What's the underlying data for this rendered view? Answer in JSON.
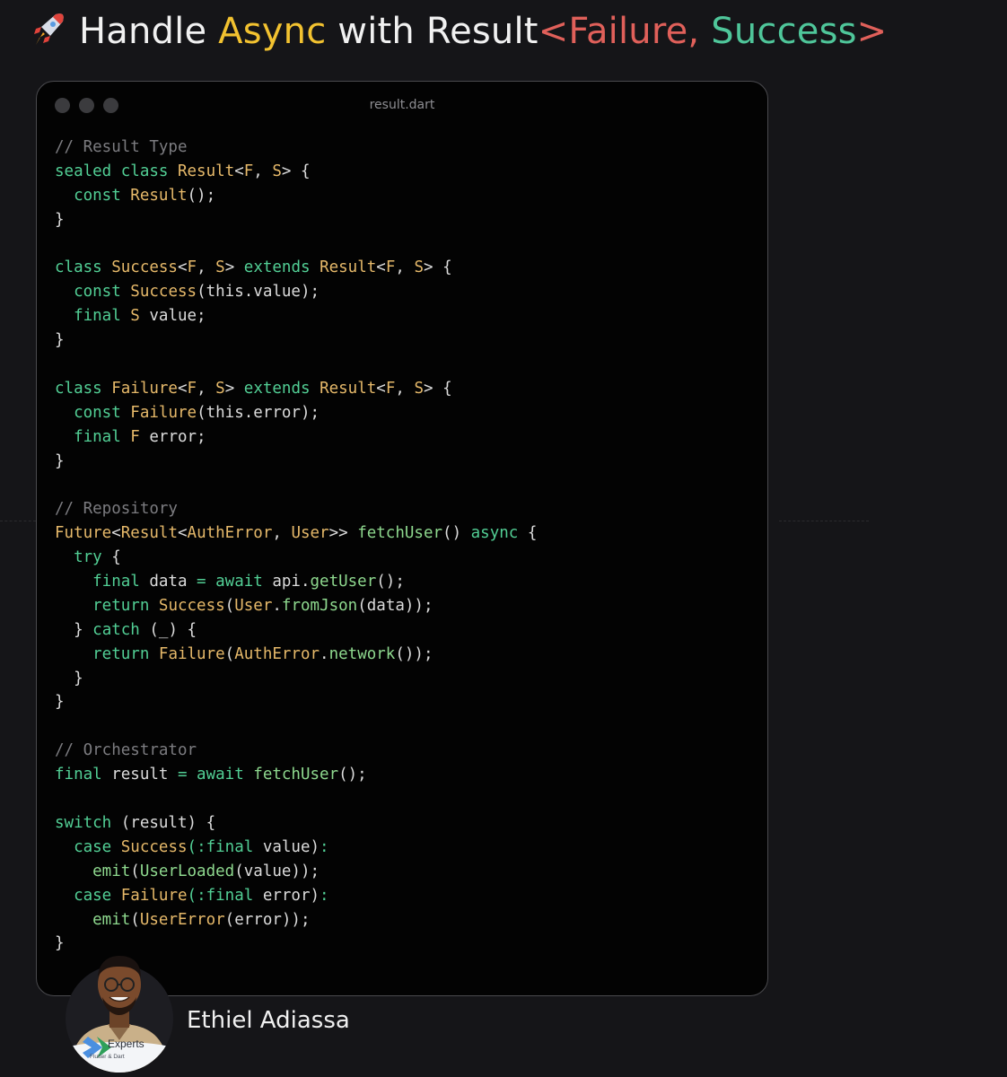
{
  "title": {
    "part1": "Handle ",
    "async": "Async",
    "part2": " with Result",
    "open": "<",
    "failure": "Failure,",
    "space": " ",
    "success": "Success",
    "close": ">"
  },
  "window": {
    "filename": "result.dart"
  },
  "code_lines": [
    [
      {
        "t": "// Result Type",
        "c": "comment"
      }
    ],
    [
      {
        "t": "sealed class ",
        "c": "kw"
      },
      {
        "t": "Result",
        "c": "type"
      },
      {
        "t": "<",
        "c": "plain"
      },
      {
        "t": "F",
        "c": "type"
      },
      {
        "t": ", ",
        "c": "plain"
      },
      {
        "t": "S",
        "c": "type"
      },
      {
        "t": "> {",
        "c": "plain"
      }
    ],
    [
      {
        "t": "  const ",
        "c": "kw"
      },
      {
        "t": "Result",
        "c": "type"
      },
      {
        "t": "();",
        "c": "plain"
      }
    ],
    [
      {
        "t": "}",
        "c": "plain"
      }
    ],
    [],
    [
      {
        "t": "class ",
        "c": "kw"
      },
      {
        "t": "Success",
        "c": "type"
      },
      {
        "t": "<",
        "c": "plain"
      },
      {
        "t": "F",
        "c": "type"
      },
      {
        "t": ", ",
        "c": "plain"
      },
      {
        "t": "S",
        "c": "type"
      },
      {
        "t": "> ",
        "c": "plain"
      },
      {
        "t": "extends ",
        "c": "kw"
      },
      {
        "t": "Result",
        "c": "type"
      },
      {
        "t": "<",
        "c": "plain"
      },
      {
        "t": "F",
        "c": "type"
      },
      {
        "t": ", ",
        "c": "plain"
      },
      {
        "t": "S",
        "c": "type"
      },
      {
        "t": "> {",
        "c": "plain"
      }
    ],
    [
      {
        "t": "  const ",
        "c": "kw"
      },
      {
        "t": "Success",
        "c": "type"
      },
      {
        "t": "(this.value);",
        "c": "plain"
      }
    ],
    [
      {
        "t": "  final ",
        "c": "kw"
      },
      {
        "t": "S",
        "c": "type"
      },
      {
        "t": " value;",
        "c": "plain"
      }
    ],
    [
      {
        "t": "}",
        "c": "plain"
      }
    ],
    [],
    [
      {
        "t": "class ",
        "c": "kw"
      },
      {
        "t": "Failure",
        "c": "type"
      },
      {
        "t": "<",
        "c": "plain"
      },
      {
        "t": "F",
        "c": "type"
      },
      {
        "t": ", ",
        "c": "plain"
      },
      {
        "t": "S",
        "c": "type"
      },
      {
        "t": "> ",
        "c": "plain"
      },
      {
        "t": "extends ",
        "c": "kw"
      },
      {
        "t": "Result",
        "c": "type"
      },
      {
        "t": "<",
        "c": "plain"
      },
      {
        "t": "F",
        "c": "type"
      },
      {
        "t": ", ",
        "c": "plain"
      },
      {
        "t": "S",
        "c": "type"
      },
      {
        "t": "> {",
        "c": "plain"
      }
    ],
    [
      {
        "t": "  const ",
        "c": "kw"
      },
      {
        "t": "Failure",
        "c": "type"
      },
      {
        "t": "(this.error);",
        "c": "plain"
      }
    ],
    [
      {
        "t": "  final ",
        "c": "kw"
      },
      {
        "t": "F",
        "c": "type"
      },
      {
        "t": " error;",
        "c": "plain"
      }
    ],
    [
      {
        "t": "}",
        "c": "plain"
      }
    ],
    [],
    [
      {
        "t": "// Repository",
        "c": "comment"
      }
    ],
    [
      {
        "t": "Future",
        "c": "type"
      },
      {
        "t": "<",
        "c": "plain"
      },
      {
        "t": "Result",
        "c": "type"
      },
      {
        "t": "<",
        "c": "plain"
      },
      {
        "t": "AuthError",
        "c": "type"
      },
      {
        "t": ", ",
        "c": "plain"
      },
      {
        "t": "User",
        "c": "type"
      },
      {
        "t": ">> ",
        "c": "plain"
      },
      {
        "t": "fetchUser",
        "c": "fn"
      },
      {
        "t": "() ",
        "c": "plain"
      },
      {
        "t": "async",
        "c": "kw"
      },
      {
        "t": " {",
        "c": "plain"
      }
    ],
    [
      {
        "t": "  try",
        "c": "kw"
      },
      {
        "t": " {",
        "c": "plain"
      }
    ],
    [
      {
        "t": "    final ",
        "c": "kw"
      },
      {
        "t": "data ",
        "c": "plain"
      },
      {
        "t": "= await ",
        "c": "kw"
      },
      {
        "t": "api.",
        "c": "plain"
      },
      {
        "t": "getUser",
        "c": "fn"
      },
      {
        "t": "();",
        "c": "plain"
      }
    ],
    [
      {
        "t": "    return ",
        "c": "kw"
      },
      {
        "t": "Success",
        "c": "type"
      },
      {
        "t": "(",
        "c": "plain"
      },
      {
        "t": "User",
        "c": "type"
      },
      {
        "t": ".",
        "c": "plain"
      },
      {
        "t": "fromJson",
        "c": "fn"
      },
      {
        "t": "(data));",
        "c": "plain"
      }
    ],
    [
      {
        "t": "  } ",
        "c": "plain"
      },
      {
        "t": "catch",
        "c": "kw"
      },
      {
        "t": " (_) {",
        "c": "plain"
      }
    ],
    [
      {
        "t": "    return ",
        "c": "kw"
      },
      {
        "t": "Failure",
        "c": "type"
      },
      {
        "t": "(",
        "c": "plain"
      },
      {
        "t": "AuthError",
        "c": "type"
      },
      {
        "t": ".",
        "c": "plain"
      },
      {
        "t": "network",
        "c": "fn"
      },
      {
        "t": "());",
        "c": "plain"
      }
    ],
    [
      {
        "t": "  }",
        "c": "plain"
      }
    ],
    [
      {
        "t": "}",
        "c": "plain"
      }
    ],
    [],
    [
      {
        "t": "// Orchestrator",
        "c": "comment"
      }
    ],
    [
      {
        "t": "final ",
        "c": "kw"
      },
      {
        "t": "result ",
        "c": "plain"
      },
      {
        "t": "= await ",
        "c": "kw"
      },
      {
        "t": "fetchUser",
        "c": "fn"
      },
      {
        "t": "();",
        "c": "plain"
      }
    ],
    [],
    [
      {
        "t": "switch",
        "c": "kw"
      },
      {
        "t": " (result) {",
        "c": "plain"
      }
    ],
    [
      {
        "t": "  case ",
        "c": "kw"
      },
      {
        "t": "Success",
        "c": "type"
      },
      {
        "t": "(:",
        "c": "kw"
      },
      {
        "t": "final ",
        "c": "kw"
      },
      {
        "t": "value)",
        "c": "plain"
      },
      {
        "t": ":",
        "c": "kw"
      }
    ],
    [
      {
        "t": "    emit",
        "c": "fn"
      },
      {
        "t": "(",
        "c": "plain"
      },
      {
        "t": "UserLoaded",
        "c": "fn"
      },
      {
        "t": "(value));",
        "c": "plain"
      }
    ],
    [
      {
        "t": "  case ",
        "c": "kw"
      },
      {
        "t": "Failure",
        "c": "type"
      },
      {
        "t": "(:",
        "c": "kw"
      },
      {
        "t": "final ",
        "c": "kw"
      },
      {
        "t": "error)",
        "c": "plain"
      },
      {
        "t": ":",
        "c": "kw"
      }
    ],
    [
      {
        "t": "    emit",
        "c": "fn"
      },
      {
        "t": "(",
        "c": "plain"
      },
      {
        "t": "UserError",
        "c": "type"
      },
      {
        "t": "(error));",
        "c": "plain"
      }
    ],
    [
      {
        "t": "}",
        "c": "plain"
      }
    ]
  ],
  "author": {
    "name": "Ethiel Adiassa",
    "badge_title": "Experts",
    "badge_subtitle": "Flutter & Dart"
  },
  "colors": {
    "background": "#151518",
    "window": "#030303",
    "keyword": "#52cf95",
    "type": "#e6b96a",
    "function": "#8ed88e",
    "comment": "#7c7c80",
    "title_async": "#f2c230",
    "title_failure": "#e0605a",
    "title_success": "#4fc69a"
  }
}
